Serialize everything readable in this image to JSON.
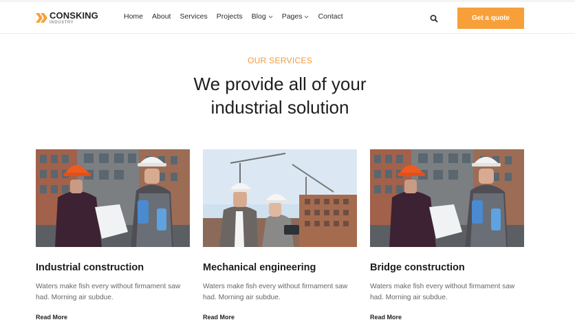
{
  "brand": {
    "name": "CONSKING",
    "subtitle": "INDUSTRY",
    "accent": "#f7a03a"
  },
  "nav": {
    "items": [
      {
        "label": "Home",
        "dropdown": false
      },
      {
        "label": "About",
        "dropdown": false
      },
      {
        "label": "Services",
        "dropdown": false
      },
      {
        "label": "Projects",
        "dropdown": false
      },
      {
        "label": "Blog",
        "dropdown": true
      },
      {
        "label": "Pages",
        "dropdown": true
      },
      {
        "label": "Contact",
        "dropdown": false
      }
    ],
    "search_icon": "search-icon",
    "cta_label": "Get a quote"
  },
  "section": {
    "eyebrow": "OUR SERVICES",
    "heading_line1": "We provide all of your",
    "heading_line2": "industrial solution"
  },
  "cards": [
    {
      "title": "Industrial construction",
      "desc": "Waters make fish every without firmament saw had. Morning air subdue.",
      "more": "Read More"
    },
    {
      "title": "Mechanical engineering",
      "desc": "Waters make fish every without firmament saw had. Morning air subdue.",
      "more": "Read More"
    },
    {
      "title": "Bridge construction",
      "desc": "Waters make fish every without firmament saw had. Morning air subdue.",
      "more": "Read More"
    }
  ]
}
